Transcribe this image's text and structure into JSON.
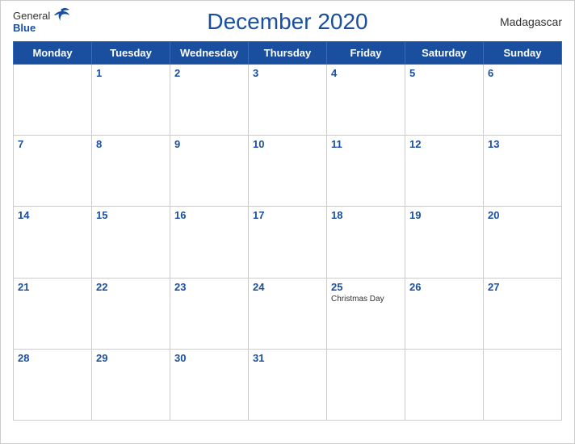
{
  "header": {
    "logo_general": "General",
    "logo_blue": "Blue",
    "month_title": "December 2020",
    "country": "Madagascar"
  },
  "weekdays": [
    "Monday",
    "Tuesday",
    "Wednesday",
    "Thursday",
    "Friday",
    "Saturday",
    "Sunday"
  ],
  "weeks": [
    [
      {
        "day": "",
        "holiday": ""
      },
      {
        "day": "1",
        "holiday": ""
      },
      {
        "day": "2",
        "holiday": ""
      },
      {
        "day": "3",
        "holiday": ""
      },
      {
        "day": "4",
        "holiday": ""
      },
      {
        "day": "5",
        "holiday": ""
      },
      {
        "day": "6",
        "holiday": ""
      }
    ],
    [
      {
        "day": "7",
        "holiday": ""
      },
      {
        "day": "8",
        "holiday": ""
      },
      {
        "day": "9",
        "holiday": ""
      },
      {
        "day": "10",
        "holiday": ""
      },
      {
        "day": "11",
        "holiday": ""
      },
      {
        "day": "12",
        "holiday": ""
      },
      {
        "day": "13",
        "holiday": ""
      }
    ],
    [
      {
        "day": "14",
        "holiday": ""
      },
      {
        "day": "15",
        "holiday": ""
      },
      {
        "day": "16",
        "holiday": ""
      },
      {
        "day": "17",
        "holiday": ""
      },
      {
        "day": "18",
        "holiday": ""
      },
      {
        "day": "19",
        "holiday": ""
      },
      {
        "day": "20",
        "holiday": ""
      }
    ],
    [
      {
        "day": "21",
        "holiday": ""
      },
      {
        "day": "22",
        "holiday": ""
      },
      {
        "day": "23",
        "holiday": ""
      },
      {
        "day": "24",
        "holiday": ""
      },
      {
        "day": "25",
        "holiday": "Christmas Day"
      },
      {
        "day": "26",
        "holiday": ""
      },
      {
        "day": "27",
        "holiday": ""
      }
    ],
    [
      {
        "day": "28",
        "holiday": ""
      },
      {
        "day": "29",
        "holiday": ""
      },
      {
        "day": "30",
        "holiday": ""
      },
      {
        "day": "31",
        "holiday": ""
      },
      {
        "day": "",
        "holiday": ""
      },
      {
        "day": "",
        "holiday": ""
      },
      {
        "day": "",
        "holiday": ""
      }
    ]
  ]
}
